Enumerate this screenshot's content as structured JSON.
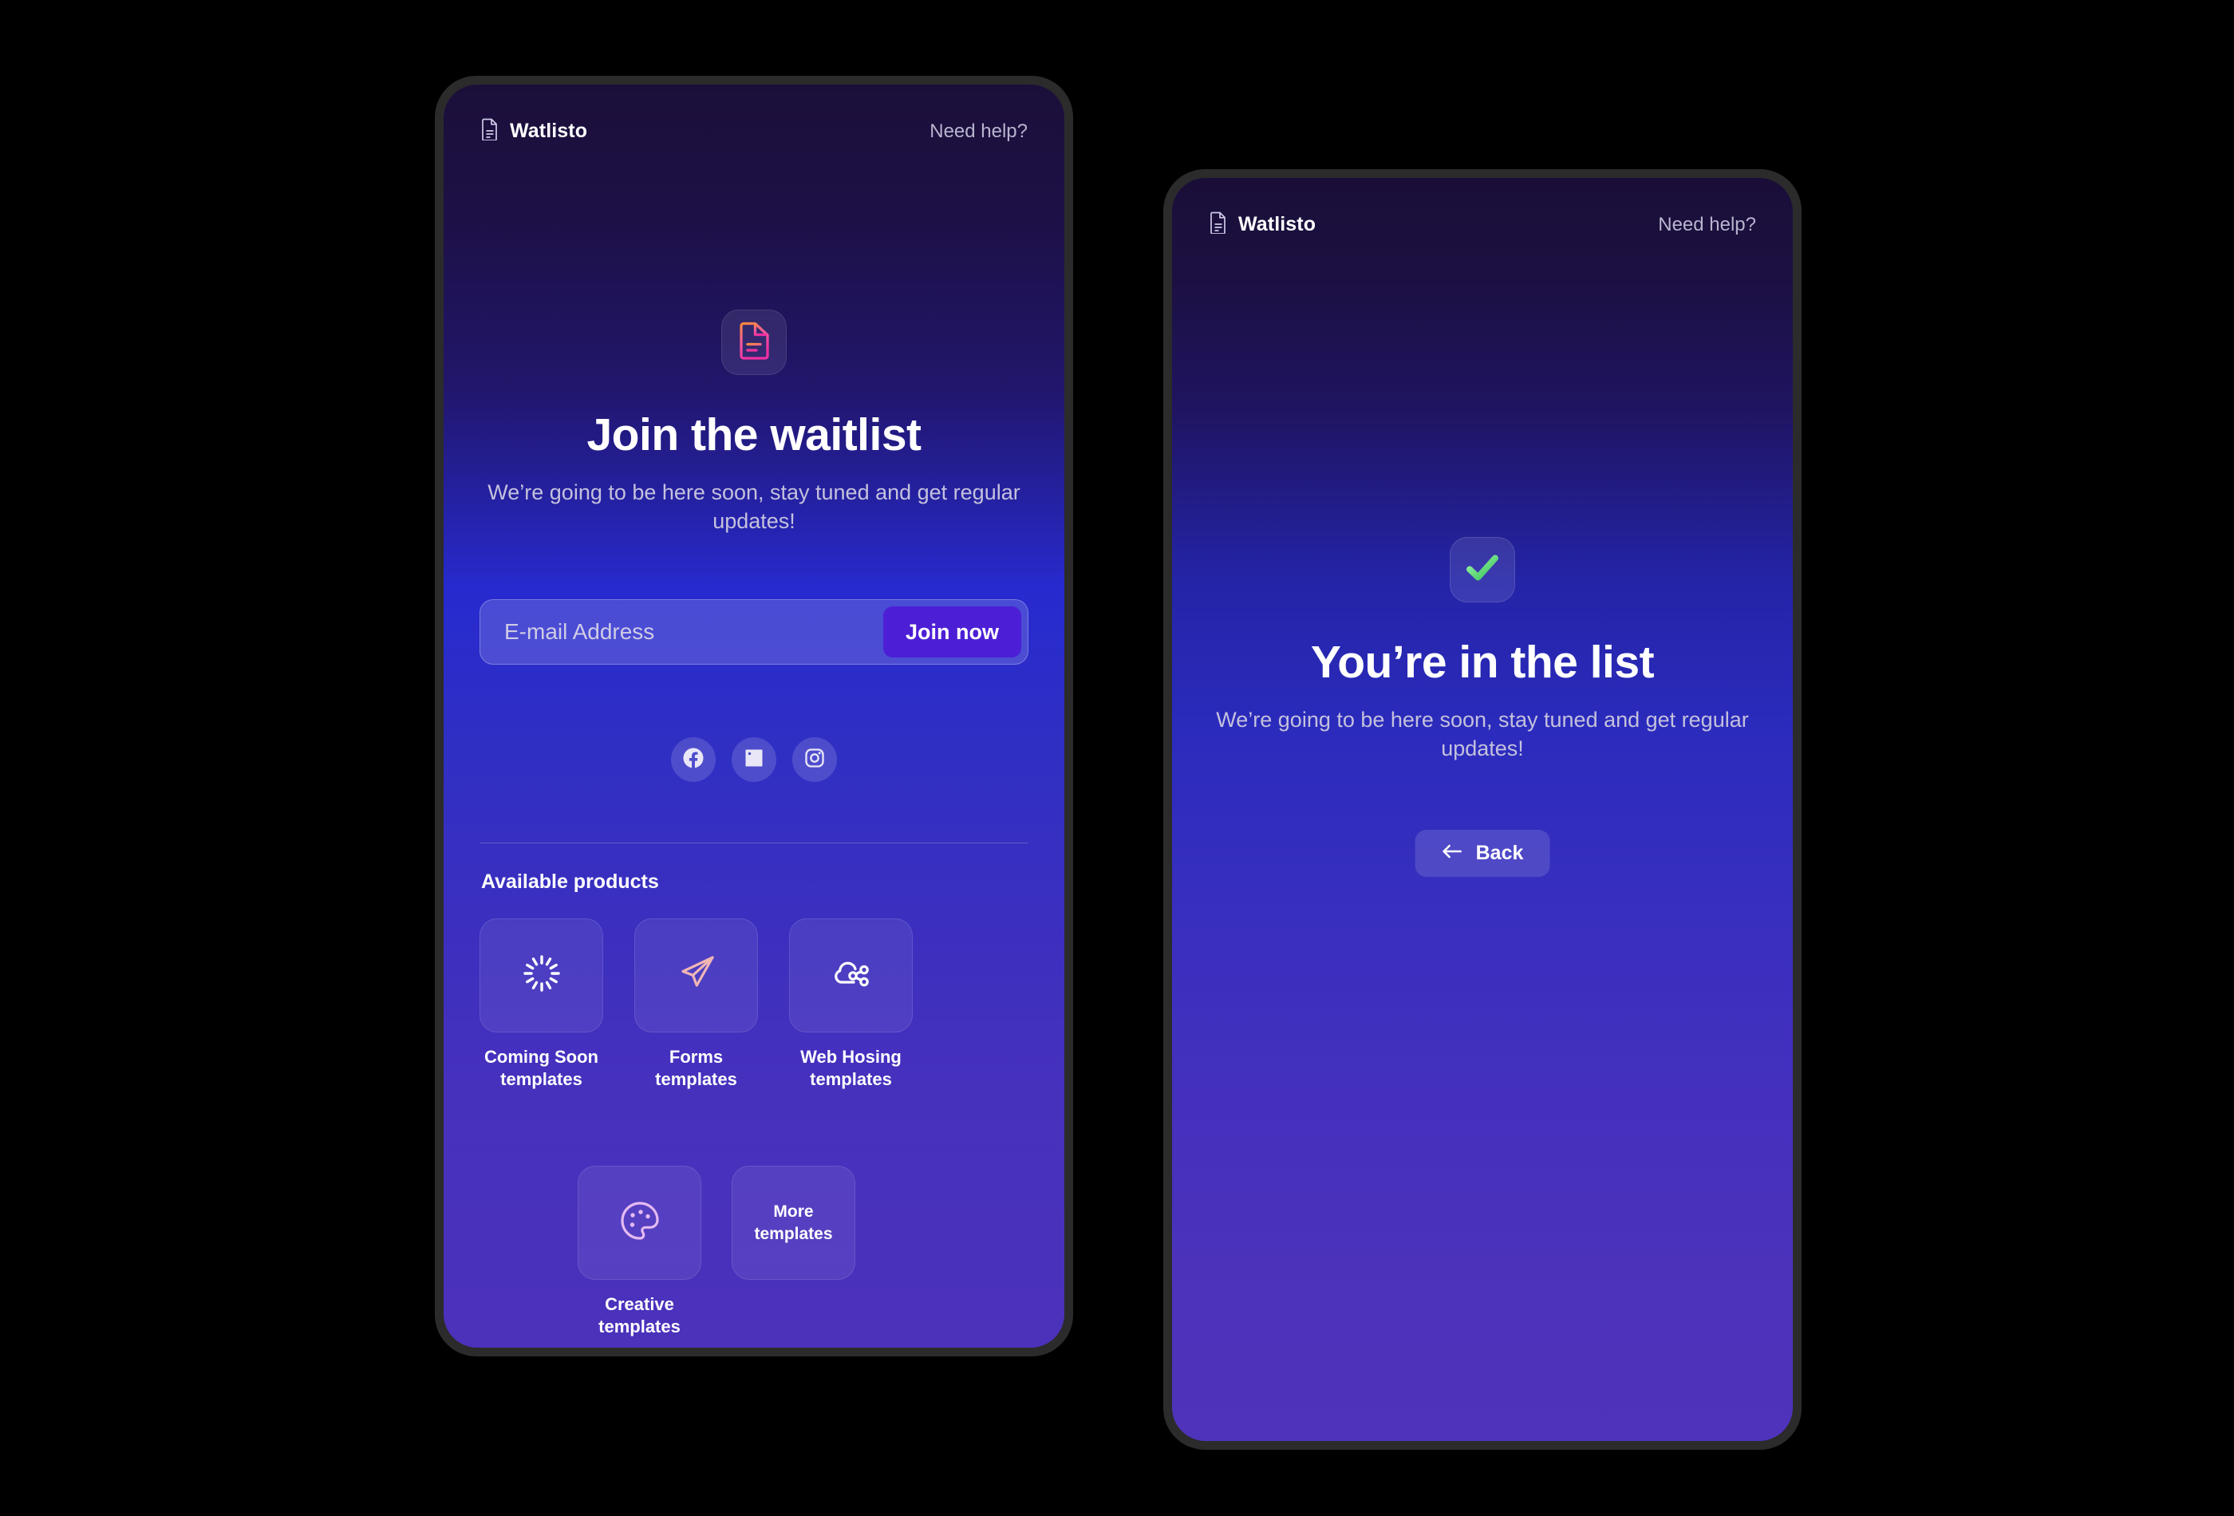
{
  "theme": {
    "page_background": "#000000",
    "phone_bezel": "#2b2b2b",
    "screen_gradient_top": "#1b0f3a",
    "screen_gradient_mid": "#272acf",
    "screen_gradient_bottom": "#4c31bb",
    "accent_button": "#4c1fd6",
    "logo_gradient_start": "#fb8a3c",
    "logo_gradient_end": "#f0359c",
    "success_green_start": "#8ef09a",
    "success_green_end": "#3ec85f",
    "muted_text": "#c4c1dd"
  },
  "screen_waitlist": {
    "header": {
      "brand_icon": "document-icon",
      "brand_name": "Watlisto",
      "help_link": "Need help?"
    },
    "hero": {
      "logo_icon": "document-gradient-icon",
      "title": "Join the waitlist",
      "subtitle": "We’re going to be here soon, stay tuned and get regular updates!"
    },
    "form": {
      "email_placeholder": "E-mail Address",
      "email_value": "",
      "submit_label": "Join now"
    },
    "social": [
      {
        "name": "facebook-icon",
        "label": "Facebook"
      },
      {
        "name": "linkedin-icon",
        "label": "LinkedIn"
      },
      {
        "name": "instagram-icon",
        "label": "Instagram"
      }
    ],
    "products": {
      "section_title": "Available products",
      "row_1": [
        {
          "icon": "spinner-icon",
          "label": "Coming Soon templates",
          "label_line_1": "Coming Soon",
          "label_line_2": "templates"
        },
        {
          "icon": "paper-plane-icon",
          "label": "Forms templates",
          "label_line_1": "Forms",
          "label_line_2": "templates"
        },
        {
          "icon": "cloud-share-icon",
          "label": "Web Hosing templates",
          "label_line_1": "Web Hosing",
          "label_line_2": "templates"
        }
      ],
      "row_2": [
        {
          "icon": "palette-icon",
          "label": "Creative templates",
          "label_line_1": "Creative",
          "label_line_2": "templates"
        },
        {
          "icon": "none",
          "card_text_line_1": "More",
          "card_text_line_2": "templates",
          "label": ""
        }
      ]
    }
  },
  "screen_success": {
    "header": {
      "brand_icon": "document-icon",
      "brand_name": "Watlisto",
      "help_link": "Need help?"
    },
    "hero": {
      "status_icon": "check-icon",
      "title": "You’re in the list",
      "subtitle": "We’re going to be here soon, stay tuned and get regular updates!"
    },
    "back_button": {
      "icon": "arrow-left-icon",
      "label": "Back"
    }
  }
}
